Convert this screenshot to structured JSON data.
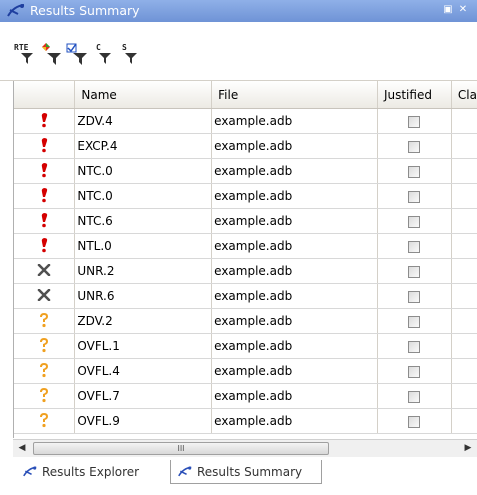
{
  "window": {
    "title": "Results Summary",
    "restore_glyph": "▣",
    "close_glyph": "✕"
  },
  "toolbar": {
    "filters": [
      {
        "name": "filter-rte",
        "label": "RTE",
        "icon": "filter-funnel-icon"
      },
      {
        "name": "filter-color",
        "label": "",
        "icon": "color-diamond-filter-icon"
      },
      {
        "name": "filter-checked",
        "label": "",
        "icon": "checkbox-filter-icon"
      },
      {
        "name": "filter-c",
        "label": "C",
        "icon": "filter-funnel-icon"
      },
      {
        "name": "filter-s",
        "label": "S",
        "icon": "filter-funnel-icon"
      }
    ]
  },
  "table": {
    "columns": [
      "",
      "Name",
      "File",
      "Justified",
      "Cla"
    ],
    "rows": [
      {
        "status": "red",
        "name": "ZDV.4",
        "file": "example.adb",
        "justified": false
      },
      {
        "status": "red",
        "name": "EXCP.4",
        "file": "example.adb",
        "justified": false
      },
      {
        "status": "red",
        "name": "NTC.0",
        "file": "example.adb",
        "justified": false
      },
      {
        "status": "red",
        "name": "NTC.0",
        "file": "example.adb",
        "justified": false
      },
      {
        "status": "red",
        "name": "NTC.6",
        "file": "example.adb",
        "justified": false
      },
      {
        "status": "red",
        "name": "NTL.0",
        "file": "example.adb",
        "justified": false
      },
      {
        "status": "gray",
        "name": "UNR.2",
        "file": "example.adb",
        "justified": false
      },
      {
        "status": "gray",
        "name": "UNR.6",
        "file": "example.adb",
        "justified": false
      },
      {
        "status": "orange",
        "name": "ZDV.2",
        "file": "example.adb",
        "justified": false
      },
      {
        "status": "orange",
        "name": "OVFL.1",
        "file": "example.adb",
        "justified": false
      },
      {
        "status": "orange",
        "name": "OVFL.4",
        "file": "example.adb",
        "justified": false
      },
      {
        "status": "orange",
        "name": "OVFL.7",
        "file": "example.adb",
        "justified": false
      },
      {
        "status": "orange",
        "name": "OVFL.9",
        "file": "example.adb",
        "justified": false
      }
    ]
  },
  "scrollbar": {
    "left_arrow": "◀",
    "right_arrow": "▶",
    "grip": "III"
  },
  "bottom_tabs": [
    {
      "label": "Results Explorer",
      "active": false
    },
    {
      "label": "Results Summary",
      "active": true
    }
  ],
  "colors": {
    "title_bar": "#7b9ddc",
    "red_check": "#d40000",
    "orange_check": "#f0a020",
    "gray_check": "#505050"
  }
}
